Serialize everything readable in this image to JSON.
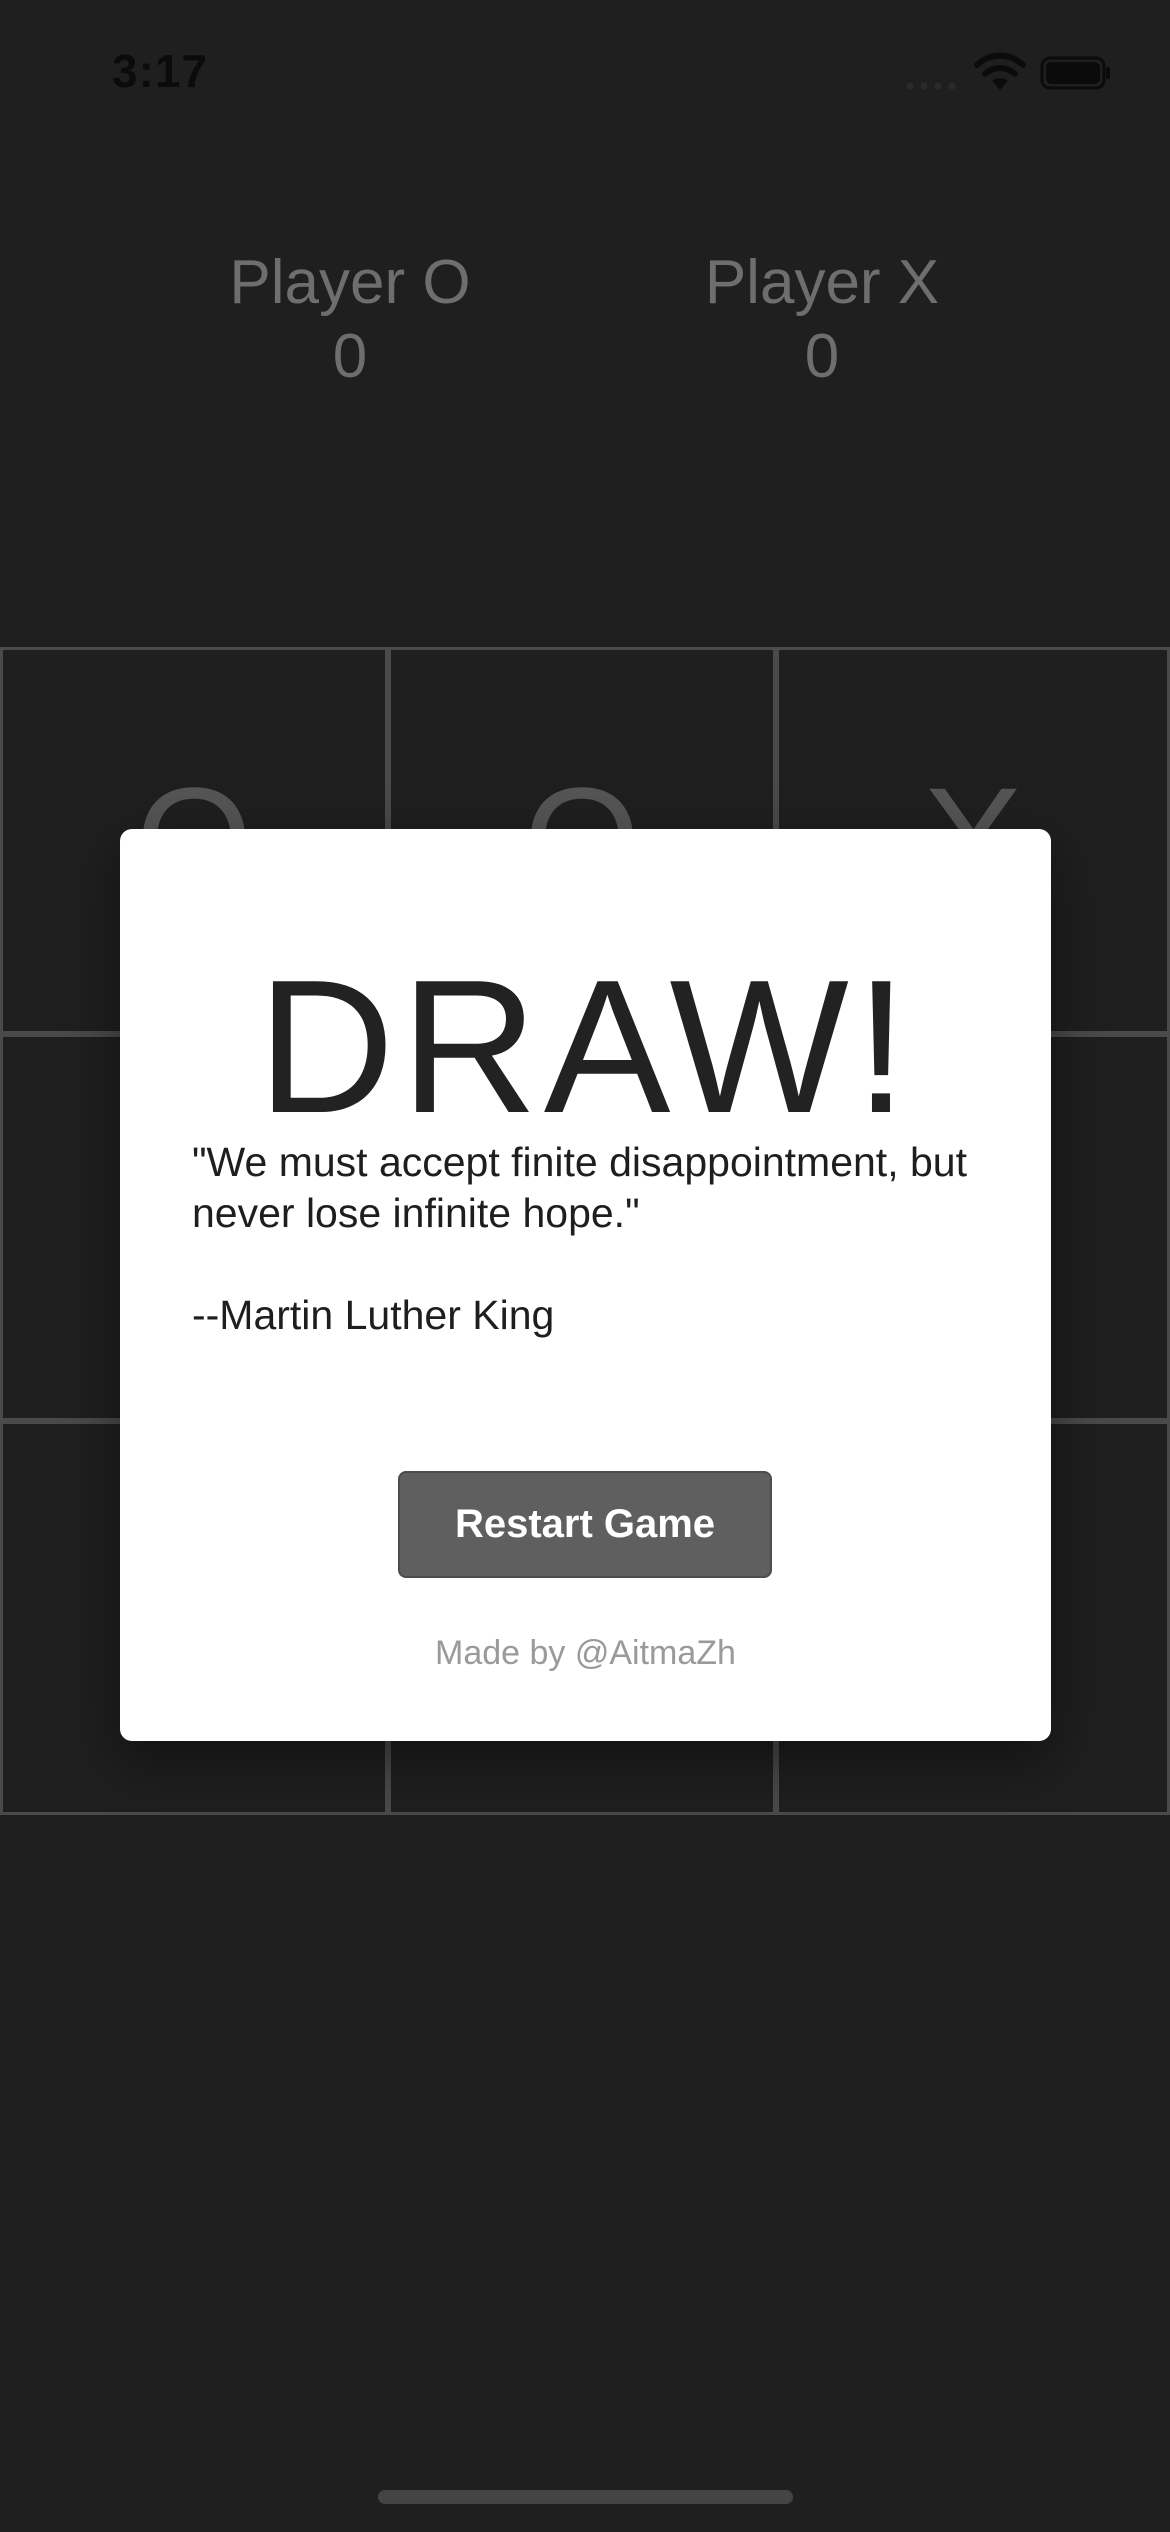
{
  "status_bar": {
    "time": "3:17"
  },
  "scoreboard": {
    "player_o": {
      "label": "Player O",
      "score": "0"
    },
    "player_x": {
      "label": "Player X",
      "score": "0"
    }
  },
  "board": {
    "cells": [
      "O",
      "O",
      "X",
      "",
      "",
      "",
      "",
      "",
      ""
    ]
  },
  "modal": {
    "title": "DRAW!",
    "quote": "\"We must accept finite disappointment, but never lose infinite hope.\"",
    "author": "--Martin Luther King",
    "restart_label": "Restart Game",
    "credit": "Made by @AitmaZh"
  },
  "colors": {
    "background": "#1f1f1f",
    "modal_background": "#ffffff",
    "button_background": "#5f5f5f"
  }
}
